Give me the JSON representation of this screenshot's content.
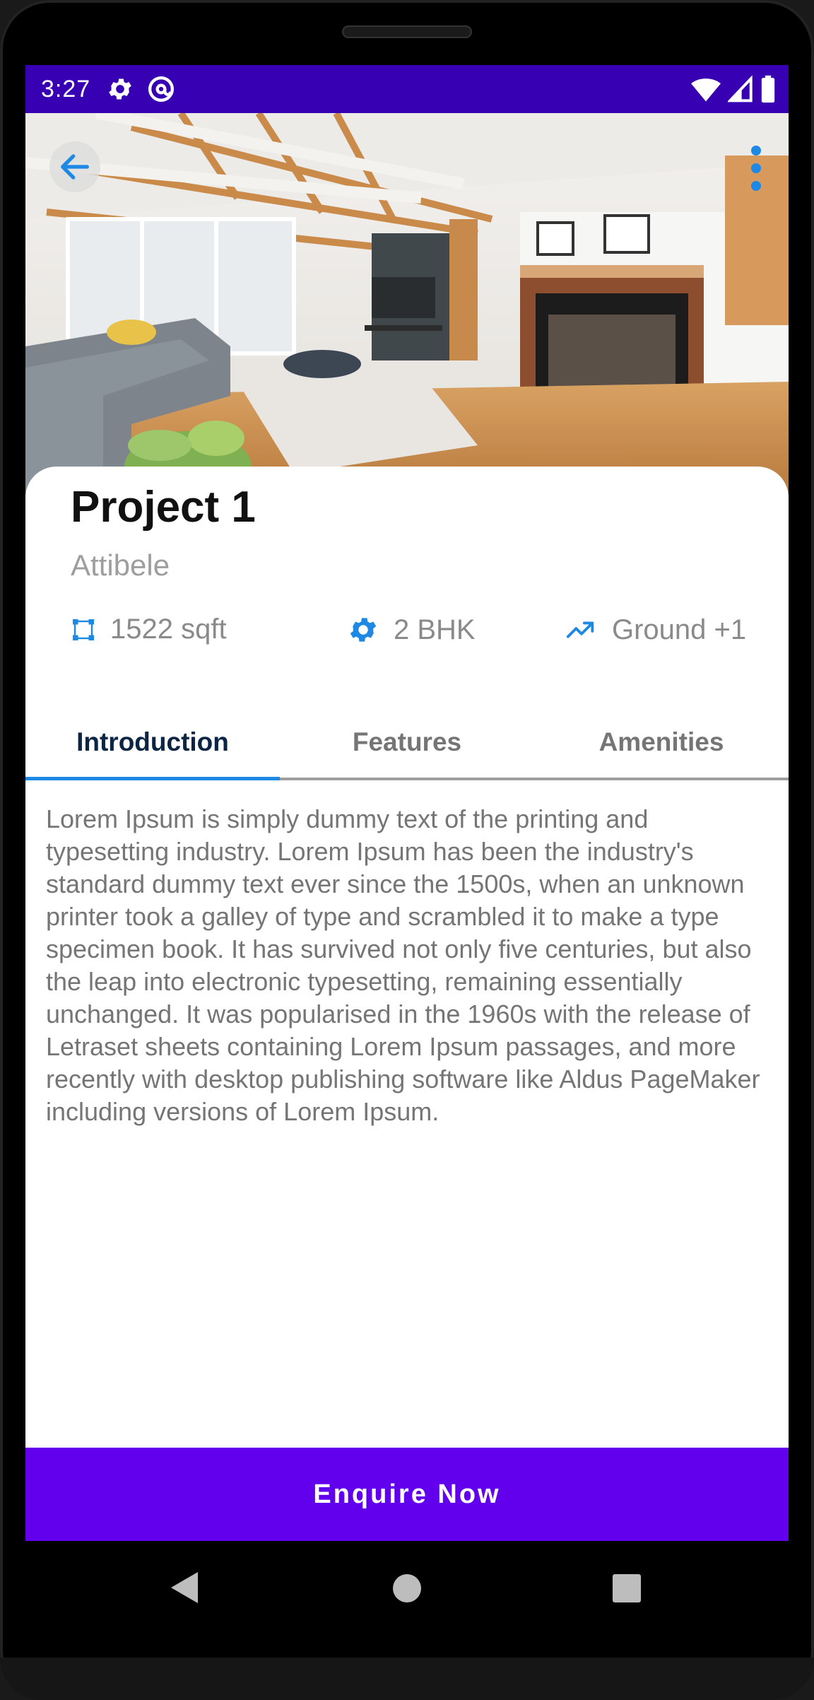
{
  "status_bar": {
    "time": "3:27",
    "left_icons": [
      "settings-gear-icon",
      "at-sign-icon"
    ],
    "right_icons": [
      "wifi-icon",
      "signal-icon",
      "battery-icon"
    ],
    "background": "#3700b3"
  },
  "hero": {
    "back_icon": "arrow-left-icon",
    "menu_icon": "more-vertical-icon",
    "image_subject": "living room interior photo"
  },
  "project": {
    "title": "Project 1",
    "location": "Attibele"
  },
  "specs": [
    {
      "icon": "area-icon",
      "label": "1522 sqft"
    },
    {
      "icon": "gear-config-icon",
      "label": "2 BHK"
    },
    {
      "icon": "trending-up-icon",
      "label": "Ground +1"
    }
  ],
  "tabs": [
    {
      "label": "Introduction",
      "active": true
    },
    {
      "label": "Features",
      "active": false
    },
    {
      "label": "Amenities",
      "active": false
    }
  ],
  "introduction": {
    "text": "Lorem Ipsum is simply dummy text of the printing and typesetting industry. Lorem Ipsum has been the industry's standard dummy text ever since the 1500s, when an unknown printer took a galley of type and scrambled it to make a type specimen book. It has survived not only five centuries, but also the leap into electronic typesetting, remaining essentially unchanged. It was popularised in the 1960s with the release of Letraset sheets containing Lorem Ipsum passages, and more recently with desktop publishing software like Aldus PageMaker including versions of Lorem Ipsum."
  },
  "cta": {
    "label": "Enquire Now",
    "color": "#6200ee"
  },
  "nav_bar": {
    "buttons": [
      "back-triangle-icon",
      "home-circle-icon",
      "recents-square-icon"
    ]
  },
  "colors": {
    "accent": "#1e88e5",
    "tab_active_text": "#0d2544",
    "muted_text": "#757575"
  }
}
